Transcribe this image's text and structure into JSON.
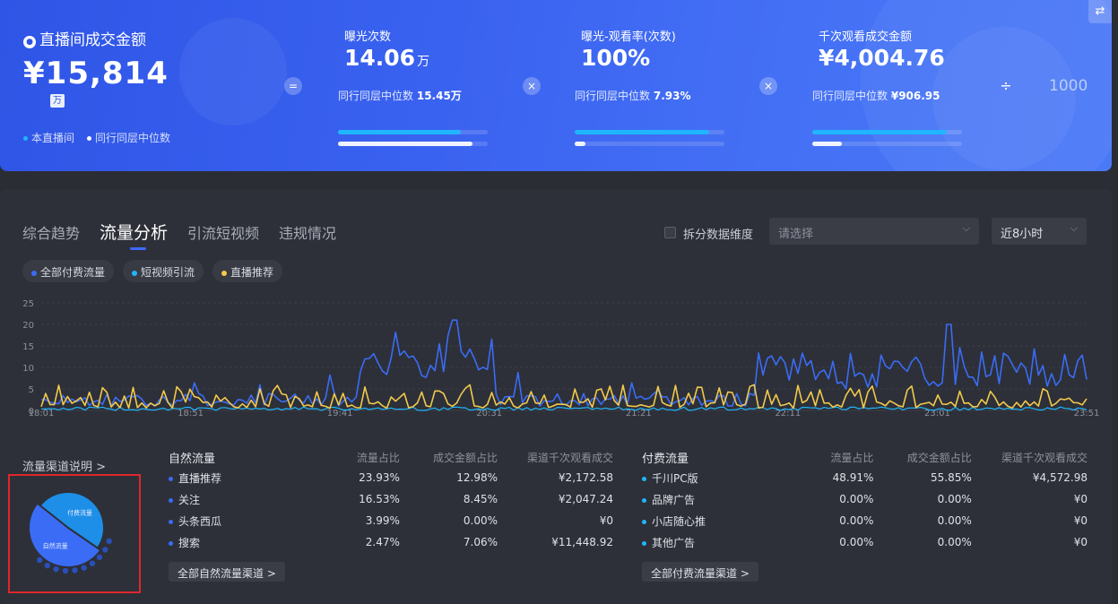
{
  "banner": {
    "swap_icon": "⇄",
    "gmv_title": "直播间成交金额",
    "gmv_value": "¥15,814",
    "gmv_unit": "万",
    "legend": [
      {
        "label": "本直播间",
        "color": "#1fb6ff"
      },
      {
        "label": "同行同层中位数",
        "color": "#ffffff"
      }
    ],
    "operators": [
      "=",
      "×",
      "×",
      "÷"
    ],
    "thousand": "1000",
    "metrics": [
      {
        "title": "曝光次数",
        "value": "14.06",
        "unit": "万",
        "peer_label": "同行同层中位数",
        "peer_value": "15.45万",
        "self_fill": 0.82,
        "peer_fill": 0.9
      },
      {
        "title": "曝光-观看率(次数)",
        "value": "100%",
        "unit": "",
        "peer_label": "同行同层中位数",
        "peer_value": "7.93%",
        "self_fill": 0.9,
        "peer_fill": 0.07
      },
      {
        "title": "千次观看成交金额",
        "value": "¥4,004.76",
        "unit": "",
        "peer_label": "同行同层中位数",
        "peer_value": "¥906.95",
        "self_fill": 0.9,
        "peer_fill": 0.2
      }
    ]
  },
  "tabs": [
    "综合趋势",
    "流量分析",
    "引流短视频",
    "违规情况"
  ],
  "active_tab": 1,
  "split": {
    "label": "拆分数据维度",
    "placeholder": "请选择"
  },
  "range_select": "近8小时",
  "series_pills": [
    {
      "label": "全部付费流量",
      "color": "#3a6cf6"
    },
    {
      "label": "短视频引流",
      "color": "#1fb6ff"
    },
    {
      "label": "直播推荐",
      "color": "#f2c94c"
    }
  ],
  "chart_data": {
    "type": "line",
    "ylim": [
      0,
      25
    ],
    "yticks": [
      0,
      5,
      10,
      15,
      20,
      25
    ],
    "xticks": [
      "18:01",
      "18:51",
      "19:41",
      "20:31",
      "21:21",
      "22:11",
      "23:01",
      "23:51"
    ],
    "series": [
      {
        "name": "全部付费流量",
        "color": "#3a6cf6"
      },
      {
        "name": "短视频引流",
        "color": "#1fb6ff"
      },
      {
        "name": "直播推荐",
        "color": "#f2c94c"
      }
    ]
  },
  "channels_link": "流量渠道说明 >",
  "pie": {
    "labels": [
      "付费流量",
      "自然流量"
    ],
    "values": [
      48.91,
      51.09
    ]
  },
  "natural": {
    "headers": [
      "自然流量",
      "流量占比",
      "成交金额占比",
      "渠道千次观看成交"
    ],
    "rows": [
      {
        "name": "直播推荐",
        "share": "23.93%",
        "gmv": "12.98%",
        "k": "¥2,172.58",
        "color": "#3a6cf6"
      },
      {
        "name": "关注",
        "share": "16.53%",
        "gmv": "8.45%",
        "k": "¥2,047.24",
        "color": "#3a6cf6"
      },
      {
        "name": "头条西瓜",
        "share": "3.99%",
        "gmv": "0.00%",
        "k": "¥0",
        "color": "#3a6cf6"
      },
      {
        "name": "搜索",
        "share": "2.47%",
        "gmv": "7.06%",
        "k": "¥11,448.92",
        "color": "#3a6cf6"
      }
    ],
    "all_btn": "全部自然流量渠道 >"
  },
  "paid": {
    "headers": [
      "付费流量",
      "流量占比",
      "成交金额占比",
      "渠道千次观看成交"
    ],
    "rows": [
      {
        "name": "千川PC版",
        "share": "48.91%",
        "gmv": "55.85%",
        "k": "¥4,572.98",
        "color": "#1fb6ff"
      },
      {
        "name": "品牌广告",
        "share": "0.00%",
        "gmv": "0.00%",
        "k": "¥0",
        "color": "#1fb6ff"
      },
      {
        "name": "小店随心推",
        "share": "0.00%",
        "gmv": "0.00%",
        "k": "¥0",
        "color": "#1fb6ff"
      },
      {
        "name": "其他广告",
        "share": "0.00%",
        "gmv": "0.00%",
        "k": "¥0",
        "color": "#1fb6ff"
      }
    ],
    "all_btn": "全部付费流量渠道 >"
  }
}
